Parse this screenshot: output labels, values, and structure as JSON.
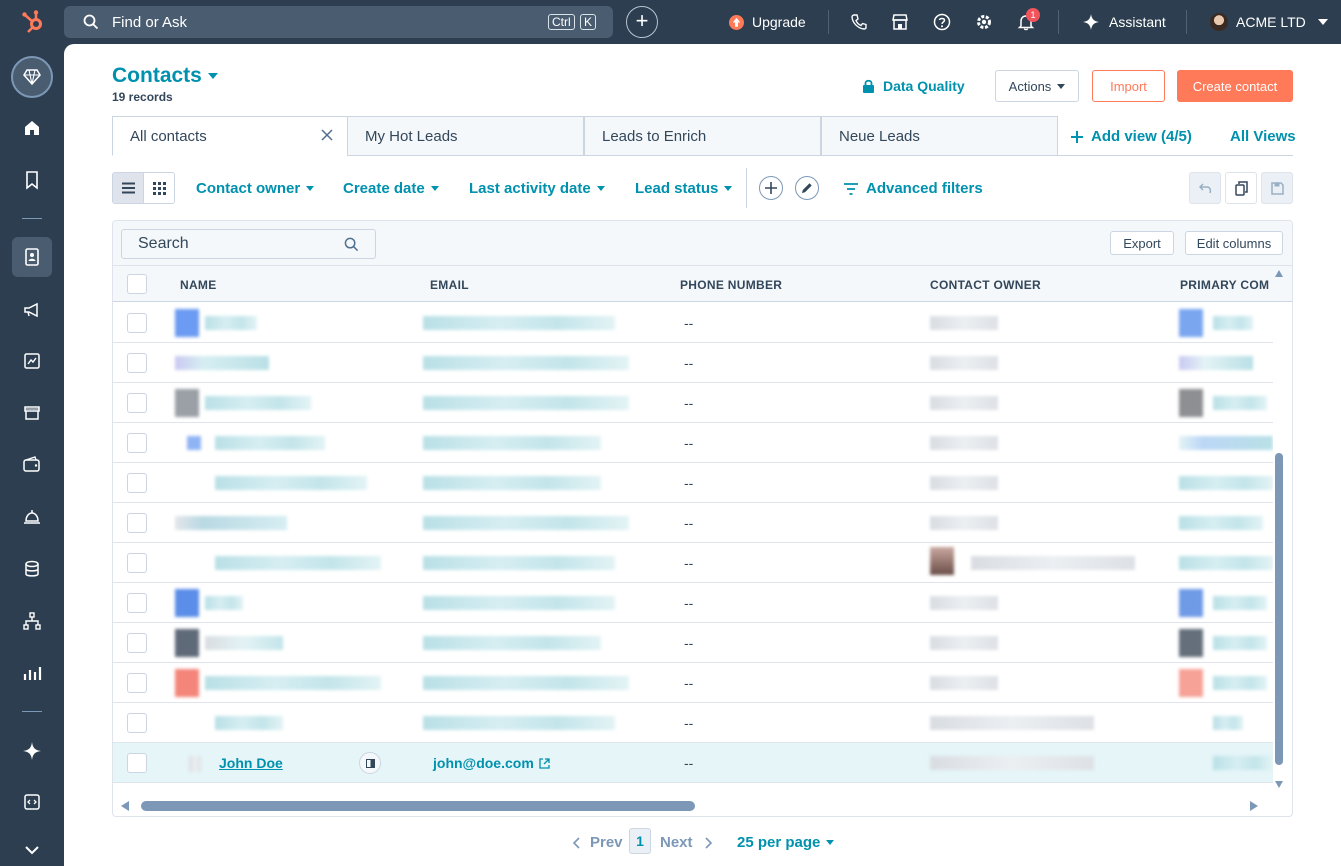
{
  "topbar": {
    "search_placeholder": "Find or Ask",
    "kbd_ctrl": "Ctrl",
    "kbd_k": "K",
    "upgrade": "Upgrade",
    "notification_count": "1",
    "assistant": "Assistant",
    "account": "ACME LTD"
  },
  "header": {
    "title": "Contacts",
    "record_count": "19 records",
    "data_quality": "Data Quality",
    "actions": "Actions",
    "import": "Import",
    "create": "Create contact"
  },
  "views": {
    "tabs": [
      "All contacts",
      "My Hot Leads",
      "Leads to Enrich",
      "Neue Leads"
    ],
    "add_view": "Add view (4/5)",
    "all_views": "All Views"
  },
  "filters": {
    "items": [
      "Contact owner",
      "Create date",
      "Last activity date",
      "Lead status"
    ],
    "advanced": "Advanced filters"
  },
  "table": {
    "search_placeholder": "Search",
    "export": "Export",
    "edit_columns": "Edit columns",
    "columns": [
      "NAME",
      "EMAIL",
      "PHONE NUMBER",
      "CONTACT OWNER",
      "PRIMARY COMI"
    ],
    "empty_phone": "--",
    "last_row": {
      "name": "John Doe",
      "email": "john@doe.com",
      "phone": "--"
    }
  },
  "pagination": {
    "prev": "Prev",
    "current": "1",
    "next": "Next",
    "per_page": "25 per page"
  },
  "colors": {
    "nav_bg": "#2d3e50",
    "accent_teal": "#0091ae",
    "accent_orange": "#ff7a59"
  }
}
